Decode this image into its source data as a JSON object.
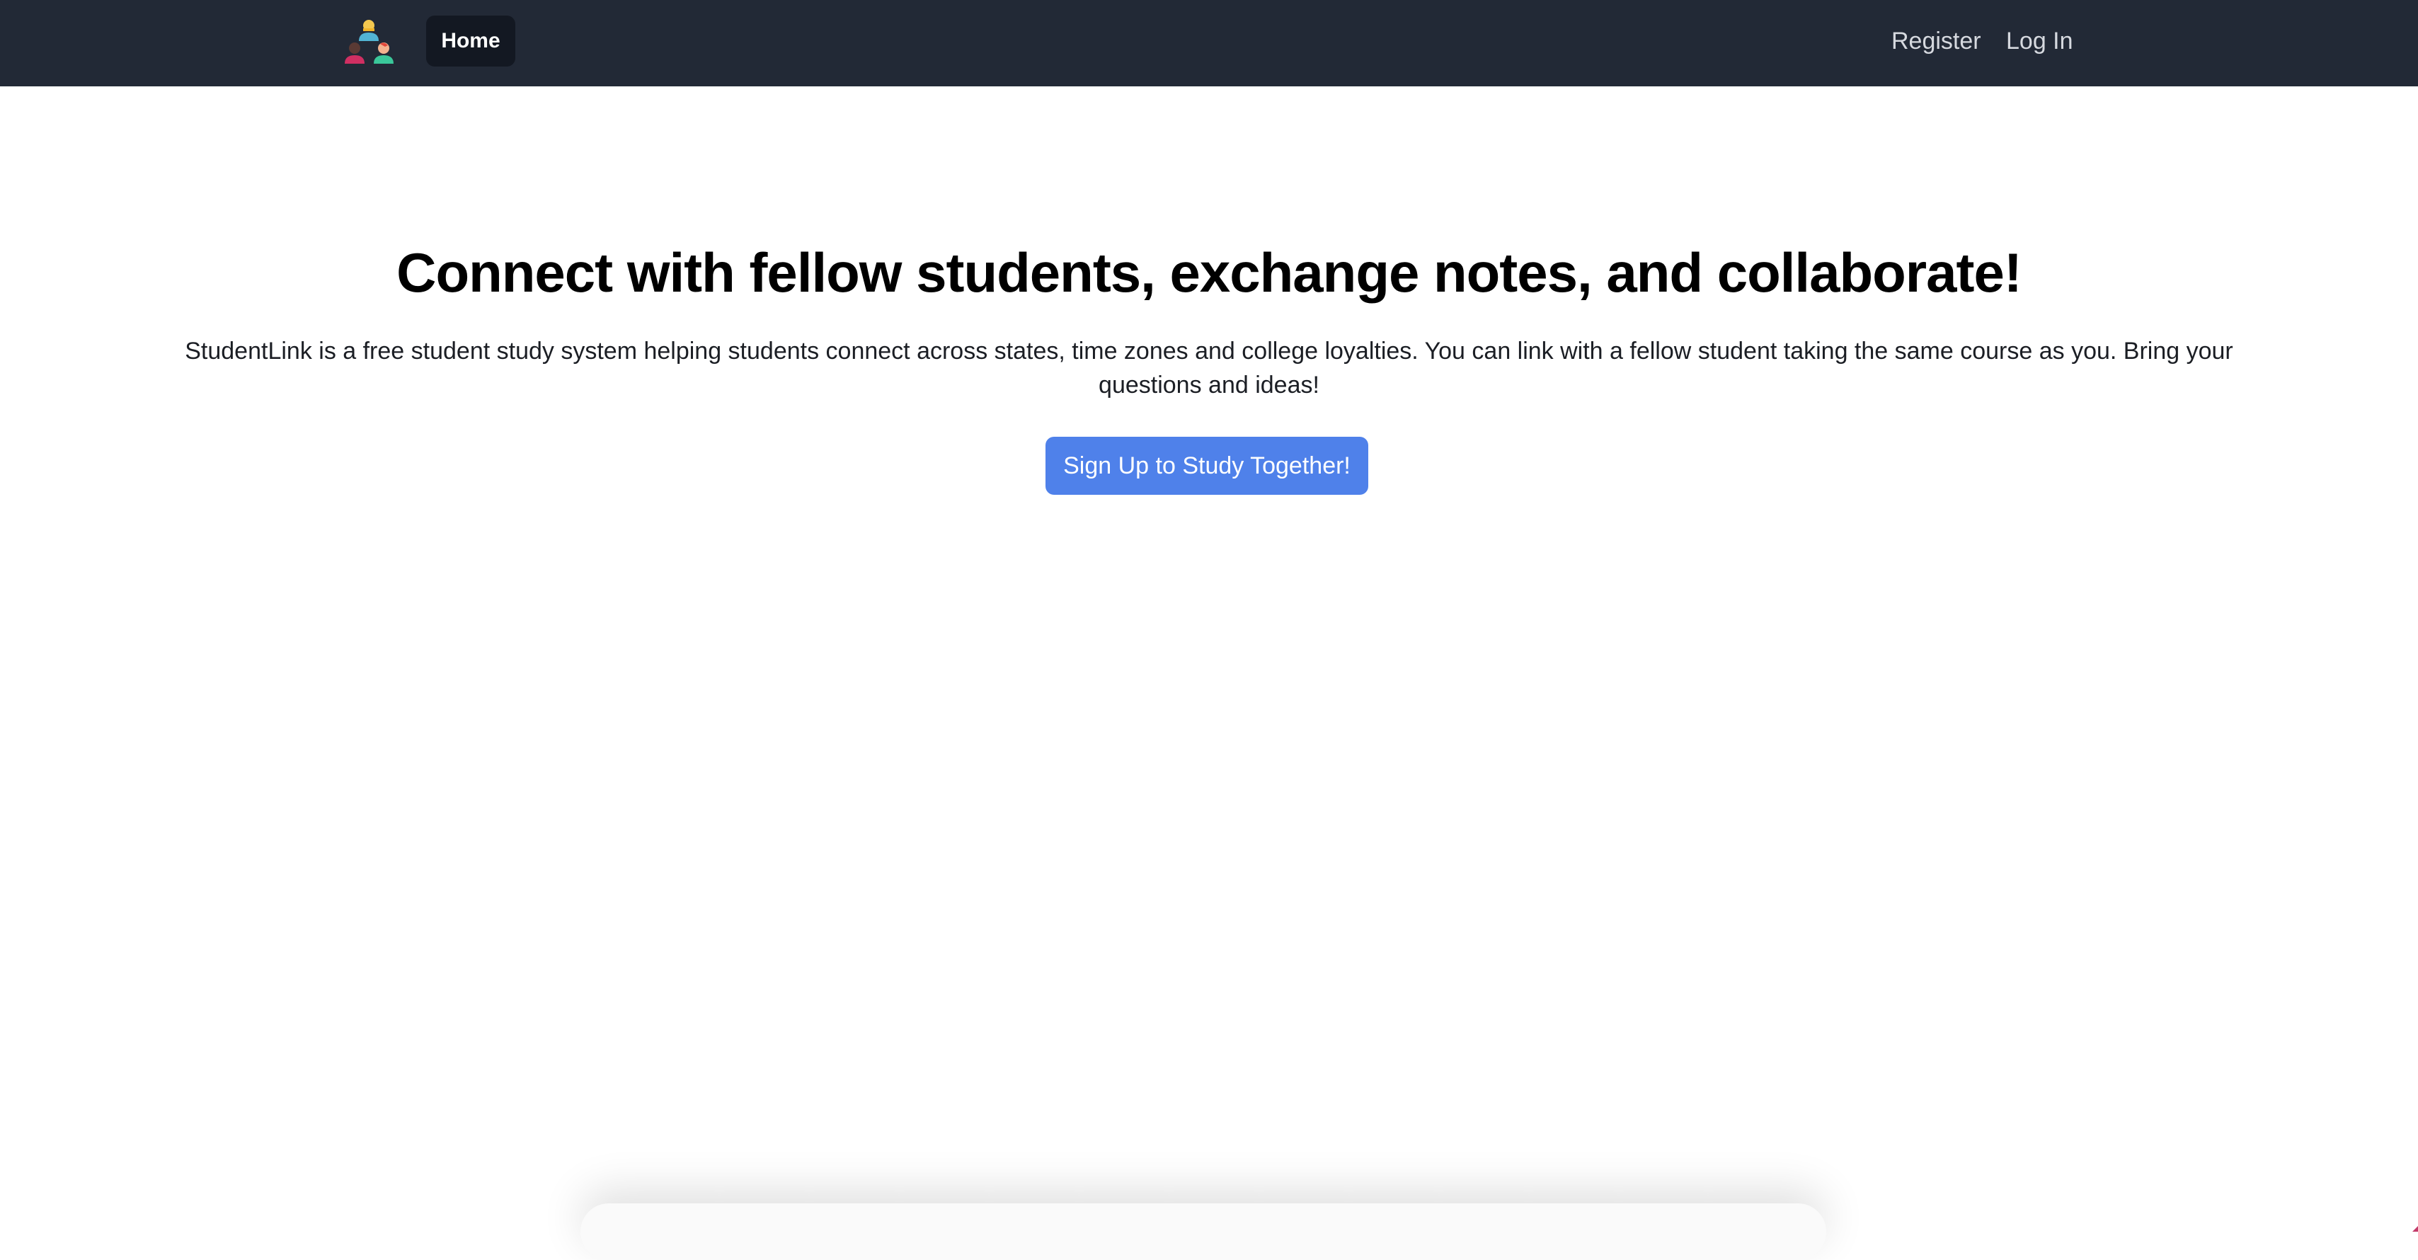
{
  "navbar": {
    "logo_icon": "students-group-icon",
    "home_label": "Home",
    "register_label": "Register",
    "login_label": "Log In",
    "background_color": "#222936"
  },
  "hero": {
    "title": "Connect with fellow students, exchange notes, and collaborate!",
    "description": "StudentLink is a free student study system helping students connect across states, time zones and college loyalties. You can link with a fellow student taking the same course as you. Bring your questions and ideas!",
    "cta_label": "Sign Up to Study Together!",
    "cta_color": "#4f81ea"
  }
}
